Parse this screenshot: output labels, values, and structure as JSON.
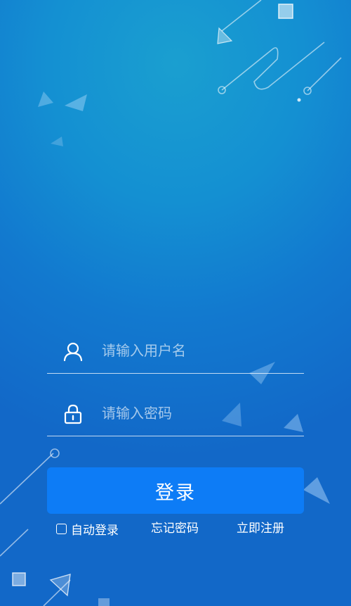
{
  "login_form": {
    "username_placeholder": "请输入用户名",
    "username_value": "",
    "password_placeholder": "请输入密码",
    "password_value": "",
    "login_button_label": "登录",
    "auto_login_label": "自动登录",
    "auto_login_checked": false,
    "forgot_password_label": "忘记密码",
    "register_label": "立即注册"
  },
  "icons": {
    "username": "user-icon",
    "password": "lock-icon"
  },
  "colors": {
    "background_top": "#1a9fd0",
    "background_bottom": "#1268c8",
    "button": "#0d7cf6",
    "text": "#ffffff"
  }
}
